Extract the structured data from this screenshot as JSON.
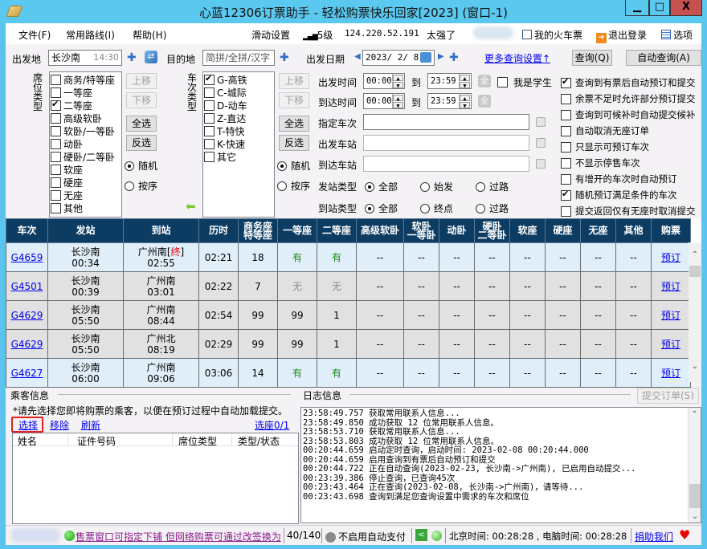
{
  "window": {
    "title": "心蓝12306订票助手 - 轻松购票快乐回家[2023] (窗口-1)",
    "minimize": "▁",
    "maximize": "□",
    "close": "X"
  },
  "menu": {
    "items": [
      "文件(F)",
      "常用路线(I)",
      "帮助(H)"
    ],
    "slide_settings": "滑动设置",
    "signal_level": "5级",
    "ip": "124.220.52.191",
    "user_nick": "太强了",
    "my_tickets": "我的火车票",
    "logout": "退出登录",
    "options": "选项"
  },
  "query": {
    "from_label": "出发地",
    "from_value": "长沙南",
    "from_time_hint": "14:30",
    "to_label": "目的地",
    "to_placeholder": "简拼/全拼/汉字",
    "date_label": "出发日期",
    "date_value": "2023/ 2/ 8",
    "more_settings": "更多查询设置↑",
    "query_btn": "查询(Q)",
    "auto_query_btn": "自动查询(A)"
  },
  "seat_types": {
    "label": "席位类型",
    "items": [
      {
        "label": "商务/特等座",
        "checked": false
      },
      {
        "label": "一等座",
        "checked": false
      },
      {
        "label": "二等座",
        "checked": true
      },
      {
        "label": "高级软卧",
        "checked": false
      },
      {
        "label": "软卧/一等卧",
        "checked": false
      },
      {
        "label": "动卧",
        "checked": false
      },
      {
        "label": "硬卧/二等卧",
        "checked": false
      },
      {
        "label": "软座",
        "checked": false
      },
      {
        "label": "硬座",
        "checked": false
      },
      {
        "label": "无座",
        "checked": false
      },
      {
        "label": "其他",
        "checked": false
      }
    ],
    "move_up": "上移",
    "move_down": "下移",
    "select_all": "全选",
    "invert": "反选",
    "random": "随机",
    "ordered": "按序"
  },
  "train_types": {
    "label": "车次类型",
    "items": [
      {
        "label": "G-高铁",
        "checked": true
      },
      {
        "label": "C-城际",
        "checked": false
      },
      {
        "label": "D-动车",
        "checked": false
      },
      {
        "label": "Z-直达",
        "checked": false
      },
      {
        "label": "T-特快",
        "checked": false
      },
      {
        "label": "K-快速",
        "checked": false
      },
      {
        "label": "其它",
        "checked": false
      }
    ],
    "move_up": "上移",
    "move_down": "下移",
    "select_all": "全选",
    "invert": "反选",
    "random": "随机",
    "ordered": "按序"
  },
  "filters": {
    "depart_time_label": "出发时间",
    "depart_from": "00:00",
    "depart_to": "23:59",
    "arrive_time_label": "到达时间",
    "arrive_from": "00:00",
    "arrive_to": "23:59",
    "to_word": "到",
    "all_btn": "全",
    "student_label": "我是学生",
    "specified_train_label": "指定车次",
    "depart_station_label": "出发车站",
    "arrive_station_label": "到达车站",
    "depart_type_label": "发站类型",
    "depart_type_options": [
      "全部",
      "始发",
      "过路"
    ],
    "arrive_type_label": "到站类型",
    "arrive_type_options": [
      "全部",
      "终点",
      "过路"
    ]
  },
  "options": [
    {
      "label": "查询到有票后自动预订和提交",
      "checked": true
    },
    {
      "label": "余票不足时允许部分预订提交",
      "checked": false
    },
    {
      "label": "查询到可候补时自动提交候补",
      "checked": false
    },
    {
      "label": "自动取消无座订单",
      "checked": false
    },
    {
      "label": "只显示可预订车次",
      "checked": false
    },
    {
      "label": "不显示停售车次",
      "checked": false
    },
    {
      "label": "有增开的车次时自动预订",
      "checked": false
    },
    {
      "label": "随机预订满足条件的车次",
      "checked": true
    },
    {
      "label": "提交返回仅有无座时取消提交",
      "checked": false
    }
  ],
  "table": {
    "headers": [
      "车次",
      "发站",
      "到站",
      "历时",
      "商务座\n特等座",
      "一等座",
      "二等座",
      "高级软卧",
      "软卧\n一等卧",
      "动卧",
      "硬卧\n二等卧",
      "软座",
      "硬座",
      "无座",
      "其他",
      "购票"
    ],
    "rows": [
      {
        "train": "G4659",
        "from": "长沙南",
        "dep": "00:34",
        "to": "广州南",
        "to_tag": "终",
        "arr": "02:55",
        "dur": "02:21",
        "biz": "18",
        "first": "有",
        "second": "有",
        "rest": [
          "--",
          "--",
          "--",
          "--",
          "--",
          "--",
          "--",
          "--"
        ],
        "book": "预订"
      },
      {
        "train": "G4501",
        "from": "长沙南",
        "dep": "00:39",
        "to": "广州南",
        "to_tag": "",
        "arr": "03:01",
        "dur": "02:22",
        "biz": "7",
        "first": "无",
        "second": "无",
        "rest": [
          "--",
          "--",
          "--",
          "--",
          "--",
          "--",
          "--",
          "--"
        ],
        "book": "预订"
      },
      {
        "train": "G4629",
        "from": "长沙南",
        "dep": "05:50",
        "to": "广州南",
        "to_tag": "",
        "arr": "08:44",
        "dur": "02:54",
        "biz": "99",
        "first": "99",
        "second": "1",
        "rest": [
          "--",
          "--",
          "--",
          "--",
          "--",
          "--",
          "--",
          "--"
        ],
        "book": "预订"
      },
      {
        "train": "G4629",
        "from": "长沙南",
        "dep": "05:50",
        "to": "广州北",
        "to_tag": "",
        "arr": "08:19",
        "dur": "02:29",
        "biz": "99",
        "first": "99",
        "second": "1",
        "rest": [
          "--",
          "--",
          "--",
          "--",
          "--",
          "--",
          "--",
          "--"
        ],
        "book": "预订"
      },
      {
        "train": "G4627",
        "from": "长沙南",
        "dep": "06:00",
        "to": "广州南",
        "to_tag": "",
        "arr": "09:06",
        "dur": "03:06",
        "biz": "14",
        "first": "有",
        "second": "有",
        "rest": [
          "--",
          "--",
          "--",
          "--",
          "--",
          "--",
          "--",
          "--"
        ],
        "book": "预订"
      }
    ]
  },
  "passengers": {
    "title": "乘客信息",
    "hint": "*请先选择您即将购票的乘客，以便在预订过程中自动加载提交。",
    "select": "选择",
    "remove": "移除",
    "refresh": "刷新",
    "seat_select": "选座0/1",
    "columns": [
      "姓名",
      "证件号码",
      "席位类型",
      "类型/状态"
    ]
  },
  "log": {
    "title": "日志信息",
    "submit_btn": "提交订单(S)",
    "lines": [
      "23:58:49.757 获取常用联系人信息...",
      "23:58:49.850 成功获取 12 位常用联系人信息。",
      "23:58:53.710 获取常用联系人信息...",
      "23:58:53.803 成功获取 12 位常用联系人信息。",
      "00:20:44.659 启动定时查询，启动时间: 2023-02-08 00:20:44.000",
      "00:20:44.659 启用查询到有票后自动预订和提交",
      "00:20:44.722 正在自动查询(2023-02-23, 长沙南->广州南), 已启用自动提交...",
      "00:23:39.386 停止查询，已查询45次",
      "00:23:43.464 正在查询(2023-02-08, 长沙南->广州南)，请等待...",
      "00:23:43.698 查询到满足您查询设置中需求的车次和席位"
    ]
  },
  "status": {
    "notice": "售票窗口可指定下铺 但网络购票可通过改签换为",
    "count": "40/140",
    "auto_pay": "不启用自动支付",
    "time_text": "北京时间: 00:28:28 , 电脑时间: 00:28:28",
    "donate": "捐助我们"
  },
  "colors": {
    "title_bar": "#5bc8ef",
    "table_header": "#0c3c62",
    "row_odd": "#dfeef8",
    "row_even": "#e1e1e1",
    "available": "#1e8a1e",
    "link": "#0000ee",
    "close_button": "#c75050"
  }
}
